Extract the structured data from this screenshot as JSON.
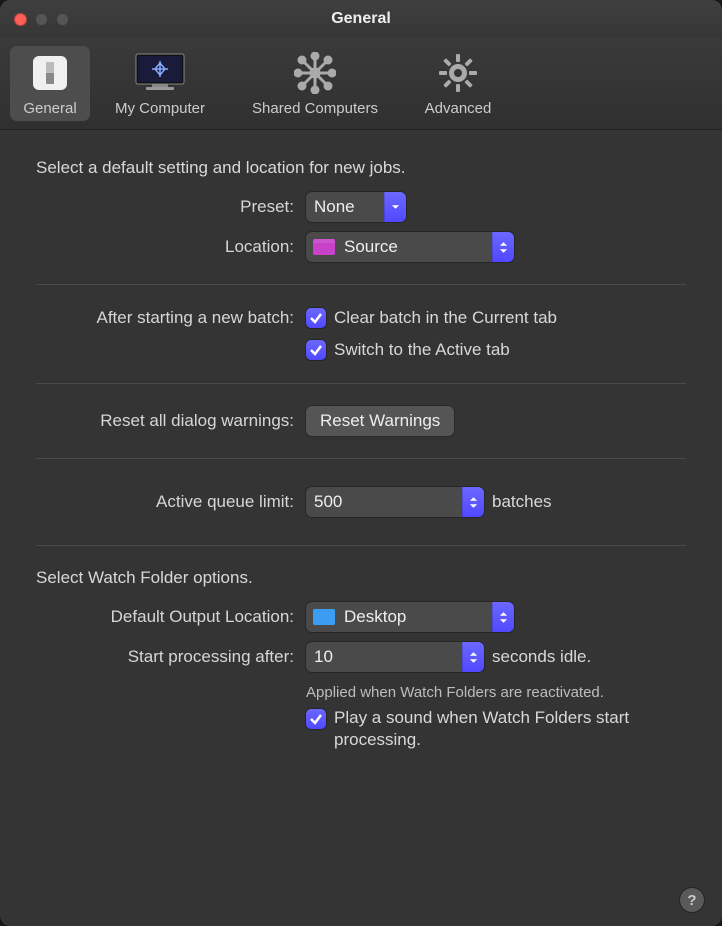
{
  "window": {
    "title": "General"
  },
  "tabs": {
    "general": "General",
    "mycomputer": "My Computer",
    "shared": "Shared Computers",
    "advanced": "Advanced"
  },
  "section1": {
    "heading": "Select a default setting and location for new jobs.",
    "preset_label": "Preset:",
    "preset_value": "None",
    "location_label": "Location:",
    "location_value": "Source"
  },
  "section2": {
    "label": "After starting a new batch:",
    "check1": "Clear batch in the Current tab",
    "check2": "Switch to the Active tab"
  },
  "section3": {
    "label": "Reset all dialog warnings:",
    "button": "Reset Warnings"
  },
  "section4": {
    "label": "Active queue limit:",
    "value": "500",
    "suffix": "batches"
  },
  "section5": {
    "heading": "Select Watch Folder options.",
    "output_label": "Default Output Location:",
    "output_value": "Desktop",
    "start_label": "Start processing after:",
    "start_value": "10",
    "start_suffix": "seconds idle.",
    "note": "Applied when Watch Folders are reactivated.",
    "check": "Play a sound when Watch Folders start processing."
  },
  "help": "?"
}
